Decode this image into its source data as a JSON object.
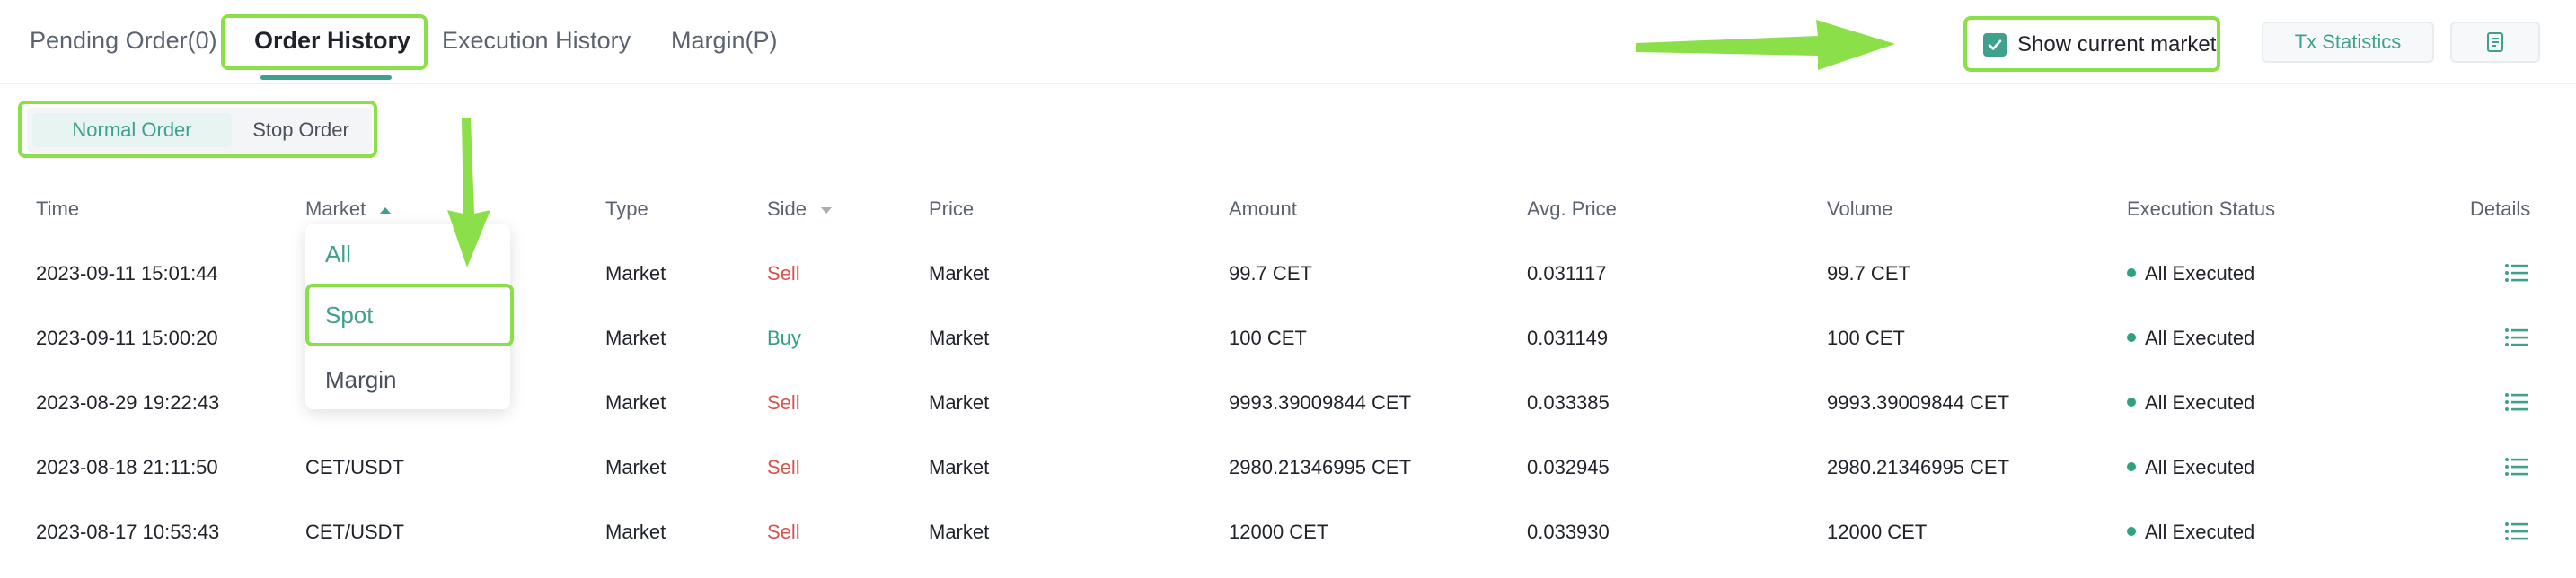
{
  "tabs": [
    {
      "label": "Pending Order(0)",
      "active": false
    },
    {
      "label": "Order History",
      "active": true
    },
    {
      "label": "Execution History",
      "active": false
    },
    {
      "label": "Margin(P)",
      "active": false
    }
  ],
  "toolbar": {
    "show_current_market_label": "Show current market",
    "show_current_market_checked": true,
    "tx_statistics_label": "Tx Statistics",
    "export_icon": "document-icon"
  },
  "order_types": [
    {
      "label": "Normal Order",
      "active": true
    },
    {
      "label": "Stop Order",
      "active": false
    }
  ],
  "table": {
    "columns": [
      "Time",
      "Market",
      "Type",
      "Side",
      "Price",
      "Amount",
      "Avg. Price",
      "Volume",
      "Execution Status",
      "Details"
    ],
    "rows": [
      {
        "time": "2023-09-11 15:01:44",
        "market": "",
        "type": "Market",
        "side": "Sell",
        "price": "Market",
        "amount": "99.7 CET",
        "avg_price": "0.031117",
        "volume": "99.7 CET",
        "status": "All Executed"
      },
      {
        "time": "2023-09-11 15:00:20",
        "market": "",
        "type": "Market",
        "side": "Buy",
        "price": "Market",
        "amount": "100 CET",
        "avg_price": "0.031149",
        "volume": "100 CET",
        "status": "All Executed"
      },
      {
        "time": "2023-08-29 19:22:43",
        "market": "",
        "type": "Market",
        "side": "Sell",
        "price": "Market",
        "amount": "9993.39009844 CET",
        "avg_price": "0.033385",
        "volume": "9993.39009844 CET",
        "status": "All Executed"
      },
      {
        "time": "2023-08-18 21:11:50",
        "market": "CET/USDT",
        "type": "Market",
        "side": "Sell",
        "price": "Market",
        "amount": "2980.21346995 CET",
        "avg_price": "0.032945",
        "volume": "2980.21346995 CET",
        "status": "All Executed"
      },
      {
        "time": "2023-08-17 10:53:43",
        "market": "CET/USDT",
        "type": "Market",
        "side": "Sell",
        "price": "Market",
        "amount": "12000 CET",
        "avg_price": "0.033930",
        "volume": "12000 CET",
        "status": "All Executed"
      }
    ]
  },
  "market_dropdown": {
    "options": [
      "All",
      "Spot",
      "Margin"
    ],
    "highlighted": "Spot"
  },
  "colors": {
    "accent": "#3fa08d",
    "sell": "#d9534f",
    "buy": "#2ea37a",
    "annotation": "#8be04a"
  }
}
